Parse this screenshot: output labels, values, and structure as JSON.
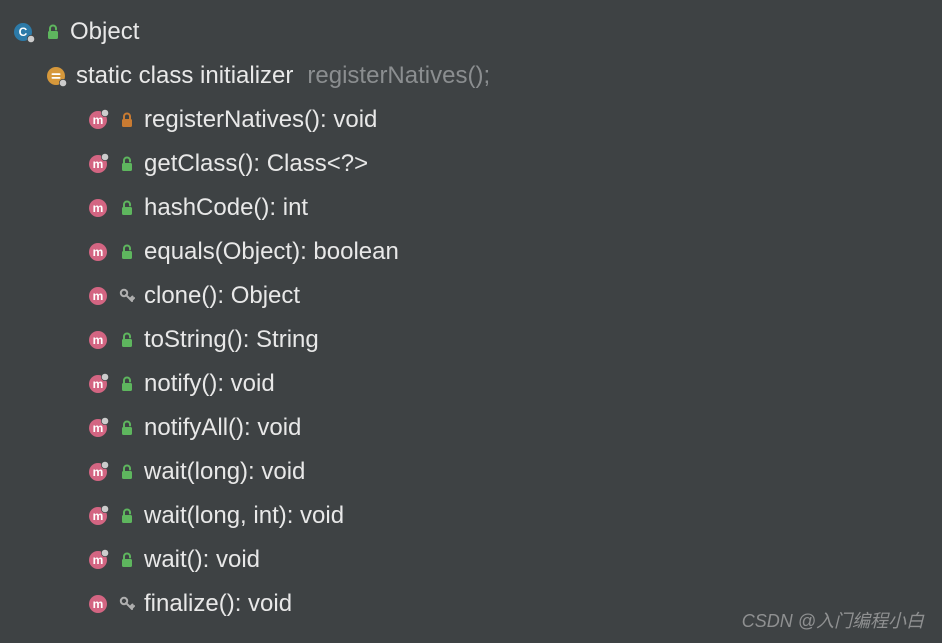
{
  "class": {
    "name": "Object"
  },
  "initializer": {
    "label": "static class initializer",
    "detail": "registerNatives();"
  },
  "members": [
    {
      "kind": "method",
      "pin": true,
      "vis": "private",
      "signature": "registerNatives(): void"
    },
    {
      "kind": "method",
      "pin": true,
      "vis": "public",
      "signature": "getClass(): Class<?>"
    },
    {
      "kind": "method",
      "pin": false,
      "vis": "public",
      "signature": "hashCode(): int"
    },
    {
      "kind": "method",
      "pin": false,
      "vis": "public",
      "signature": "equals(Object): boolean"
    },
    {
      "kind": "method",
      "pin": false,
      "vis": "protected",
      "signature": "clone(): Object"
    },
    {
      "kind": "method",
      "pin": false,
      "vis": "public",
      "signature": "toString(): String"
    },
    {
      "kind": "method",
      "pin": true,
      "vis": "public",
      "signature": "notify(): void"
    },
    {
      "kind": "method",
      "pin": true,
      "vis": "public",
      "signature": "notifyAll(): void"
    },
    {
      "kind": "method",
      "pin": true,
      "vis": "public",
      "signature": "wait(long): void"
    },
    {
      "kind": "method",
      "pin": true,
      "vis": "public",
      "signature": "wait(long, int): void"
    },
    {
      "kind": "method",
      "pin": true,
      "vis": "public",
      "signature": "wait(): void"
    },
    {
      "kind": "method",
      "pin": false,
      "vis": "protected",
      "signature": "finalize(): void"
    }
  ],
  "watermark": "CSDN @入门编程小白",
  "colors": {
    "bg": "#3e4244",
    "text": "#e8e8e8",
    "muted": "#8b8e90",
    "class_icon_bg": "#2c7aa8",
    "method_icon_bg": "#d36582",
    "method_icon_fg": "#ffffff",
    "initializer_bg": "#d6983b",
    "lock_public": "#5eb65e",
    "lock_private": "#c97b32",
    "key_protected": "#b0b0b0",
    "pin_overlay": "#cccccc"
  }
}
